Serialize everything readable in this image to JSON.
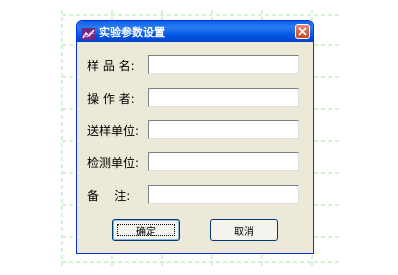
{
  "window": {
    "title": "实验参数设置",
    "icon": "chart-app-icon",
    "close_icon": "close-icon"
  },
  "form": {
    "fields": [
      {
        "label": "样 品 名:",
        "value": ""
      },
      {
        "label": "操 作 者:",
        "value": ""
      },
      {
        "label": "送样单位:",
        "value": ""
      },
      {
        "label": "检测单位:",
        "value": ""
      },
      {
        "label": "备    注:",
        "value": ""
      }
    ]
  },
  "buttons": {
    "ok_label": "确定",
    "cancel_label": "取消"
  },
  "colors": {
    "titlebar": "#0054e3",
    "dialog_bg": "#ece9d8",
    "grid": "#9fe39f"
  }
}
